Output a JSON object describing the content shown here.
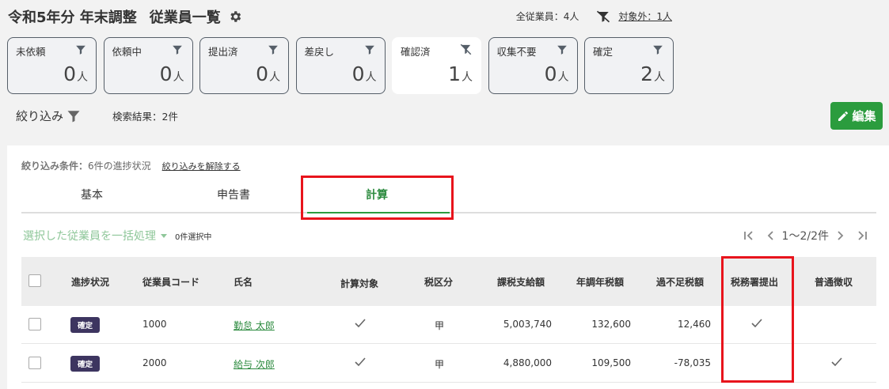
{
  "header": {
    "title": "令和5年分 年末調整",
    "subtitle": "従業員一覧",
    "all_employees": "全従業員：4人",
    "excluded": "対象外：1人"
  },
  "status_cards": [
    {
      "label": "未依頼",
      "count": "0",
      "unit": "人",
      "active": false,
      "filter_icon": "filter-icon"
    },
    {
      "label": "依頼中",
      "count": "0",
      "unit": "人",
      "active": false,
      "filter_icon": "filter-icon"
    },
    {
      "label": "提出済",
      "count": "0",
      "unit": "人",
      "active": false,
      "filter_icon": "filter-icon"
    },
    {
      "label": "差戻し",
      "count": "0",
      "unit": "人",
      "active": false,
      "filter_icon": "filter-icon"
    },
    {
      "label": "確認済",
      "count": "1",
      "unit": "人",
      "active": true,
      "filter_icon": "filter-off-icon"
    },
    {
      "label": "収集不要",
      "count": "0",
      "unit": "人",
      "active": false,
      "filter_icon": "filter-icon"
    },
    {
      "label": "確定",
      "count": "2",
      "unit": "人",
      "active": false,
      "filter_icon": "filter-icon"
    }
  ],
  "filterbar": {
    "label": "絞り込み",
    "result": "検索結果：2件"
  },
  "edit_button": {
    "label": "編集"
  },
  "condition": {
    "label": "絞り込み条件：",
    "value": "6件の進捗状況",
    "clear_link": "絞り込みを解除する"
  },
  "tabs": [
    {
      "label": "基本"
    },
    {
      "label": "申告書"
    },
    {
      "label": "計算"
    }
  ],
  "bulk": {
    "label": "選択した従業員を一括処理",
    "selected": "0件選択中"
  },
  "pager": {
    "text": "1〜2/2件"
  },
  "table": {
    "headers": [
      "進捗状況",
      "従業員コード",
      "氏名",
      "計算対象",
      "税区分",
      "課税支給額",
      "年調年税額",
      "過不足税額",
      "税務署提出",
      "普通徴収"
    ],
    "rows": [
      {
        "status": "確定",
        "code": "1000",
        "name": "勤怠 太郎",
        "calc_target": true,
        "tax_class": "甲",
        "taxable_pay": "5,003,740",
        "annual_tax": "132,600",
        "diff_tax": "12,460",
        "tax_office": true,
        "ordinary": false
      },
      {
        "status": "確定",
        "code": "2000",
        "name": "給与 次郎",
        "calc_target": true,
        "tax_class": "甲",
        "taxable_pay": "4,880,000",
        "annual_tax": "109,500",
        "diff_tax": "-78,035",
        "tax_office": false,
        "ordinary": true
      }
    ]
  },
  "colors": {
    "accent_green": "#2b9c3e",
    "highlight_red": "#e8141c",
    "badge_bg": "#3d3560"
  }
}
